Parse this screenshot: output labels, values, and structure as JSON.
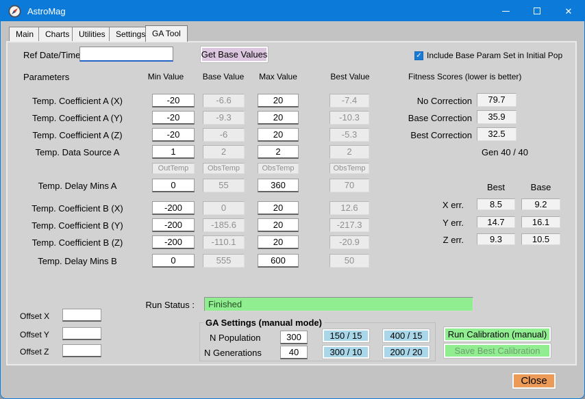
{
  "window": {
    "title": "AstroMag"
  },
  "icons": {
    "check": "✓",
    "close_window": "✕"
  },
  "tabs": {
    "items": [
      {
        "label": "Main"
      },
      {
        "label": "Charts"
      },
      {
        "label": "Utilities"
      },
      {
        "label": "Settings"
      },
      {
        "label": "GA Tool"
      }
    ],
    "active": "GA Tool"
  },
  "header_controls": {
    "ref_label": "Ref Date/Time",
    "ref_value": "",
    "get_base": "Get Base Values",
    "include_checkbox": "Include Base Param Set in Initial Pop",
    "checkbox_checked": true
  },
  "params": {
    "section_label": "Parameters",
    "columns": {
      "min": "Min Value",
      "base": "Base Value",
      "max": "Max Value",
      "best": "Best Value"
    },
    "rows": [
      {
        "label": "Temp. Coefficient A (X)",
        "min": "-20",
        "base": "-6.6",
        "max": "20",
        "best": "-7.4"
      },
      {
        "label": "Temp. Coefficient A (Y)",
        "min": "-20",
        "base": "-9.3",
        "max": "20",
        "best": "-10.3"
      },
      {
        "label": "Temp. Coefficient A (Z)",
        "min": "-20",
        "base": "-6",
        "max": "20",
        "best": "-5.3"
      },
      {
        "label": "Temp. Data Source A",
        "min": "1",
        "base": "2",
        "max": "2",
        "best": "2"
      },
      {
        "label": "",
        "min": "OutTemp",
        "base": "ObsTemp",
        "max": "ObsTemp",
        "best": "ObsTemp"
      },
      {
        "label": "Temp. Delay Mins A",
        "min": "0",
        "base": "55",
        "max": "360",
        "best": "70"
      },
      {
        "label": "Temp. Coefficient B (X)",
        "min": "-200",
        "base": "0",
        "max": "20",
        "best": "12.6"
      },
      {
        "label": "Temp. Coefficient B (Y)",
        "min": "-200",
        "base": "-185.6",
        "max": "20",
        "best": "-217.3"
      },
      {
        "label": "Temp. Coefficient B (Z)",
        "min": "-200",
        "base": "-110.1",
        "max": "20",
        "best": "-20.9"
      },
      {
        "label": "Temp. Delay Mins B",
        "min": "0",
        "base": "555",
        "max": "600",
        "best": "50"
      }
    ]
  },
  "fitness": {
    "header": "Fitness Scores (lower is better)",
    "rows": [
      {
        "label": "No Correction",
        "value": "79.7"
      },
      {
        "label": "Base Correction",
        "value": "35.9"
      },
      {
        "label": "Best Correction",
        "value": "32.5"
      }
    ],
    "gen": "Gen 40 / 40"
  },
  "errors": {
    "best_header": "Best",
    "base_header": "Base",
    "rows": [
      {
        "label": "X err.",
        "best": "8.5",
        "base": "9.2"
      },
      {
        "label": "Y err.",
        "best": "14.7",
        "base": "16.1"
      },
      {
        "label": "Z err.",
        "best": "9.3",
        "base": "10.5"
      }
    ]
  },
  "run_status": {
    "label": "Run Status :",
    "value": "Finished"
  },
  "offsets": {
    "rows": [
      {
        "label": "Offset X",
        "value": ""
      },
      {
        "label": "Offset Y",
        "value": ""
      },
      {
        "label": "Offset Z",
        "value": ""
      }
    ]
  },
  "ga_settings": {
    "title": "GA Settings (manual mode)",
    "population_label": "N Population",
    "population_value": "300",
    "generations_label": "N Generations",
    "generations_value": "40",
    "presets": [
      "150 / 15",
      "400 / 15",
      "300 / 10",
      "200 / 20"
    ]
  },
  "actions": {
    "run": "Run Calibration (manual)",
    "save": "Save Best Calibration",
    "close": "Close"
  },
  "colors": {
    "titlebar": "#0b7ad9",
    "accent_blue": "#1a7ad4",
    "status_green": "#90ee90",
    "preset_blue": "#a9d6e8",
    "action_green": "#90ee90",
    "close_orange": "#ec9a57",
    "get_base_purple": "#dcc6df"
  }
}
